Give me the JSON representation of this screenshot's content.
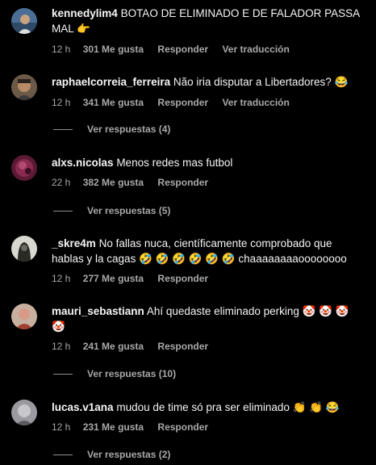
{
  "comments": [
    {
      "username": "kennedylim4",
      "text": "BOTAO DE ELIMINADO E DE FALADOR PASSA MAL 👉",
      "time": "12 h",
      "likes": "301 Me gusta",
      "reply": "Responder",
      "translate": "Ver traducción",
      "avatar_color": "#5a7fa8"
    },
    {
      "username": "raphaelcorreia_ferreira",
      "text": "Não iria disputar a Libertadores? 😂",
      "time": "12 h",
      "likes": "341 Me gusta",
      "reply": "Responder",
      "translate": "Ver traducción",
      "replies": "Ver respuestas (4)",
      "avatar_color": "#8a6a4a"
    },
    {
      "username": "alxs.nicolas",
      "text": "Menos redes mas futbol",
      "time": "22 h",
      "likes": "382 Me gusta",
      "reply": "Responder",
      "replies": "Ver respuestas (5)",
      "avatar_color": "#7a2a4a"
    },
    {
      "username": "_skre4m",
      "text": "No fallas nuca, científicamente comprobado que hablas y la cagas 🤣 🤣 🤣 🤣 🤣 🤣 chaaaaaaaaoooooooo",
      "time": "12 h",
      "likes": "277 Me gusta",
      "reply": "Responder",
      "avatar_color": "#3a3a32"
    },
    {
      "username": "mauri_sebastiann",
      "text": "Ahí quedaste eliminado perking 🤡 🤡 🤡 🤡",
      "time": "12 h",
      "likes": "241 Me gusta",
      "reply": "Responder",
      "replies": "Ver respuestas (10)",
      "avatar_color": "#b07060"
    },
    {
      "username": "lucas.v1ana",
      "text": "mudou de time só pra ser eliminado 👏 👏 😂",
      "time": "12 h",
      "likes": "231 Me gusta",
      "reply": "Responder",
      "replies": "Ver respuestas (2)",
      "avatar_color": "#8a8a90"
    }
  ]
}
